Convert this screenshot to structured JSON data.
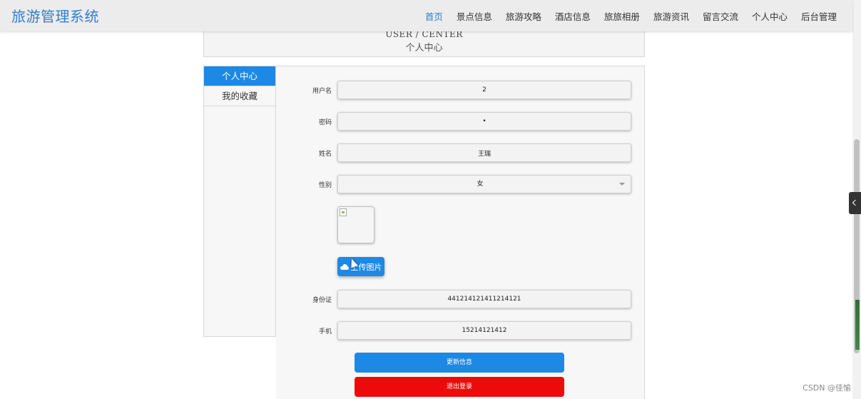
{
  "app": {
    "title": "旅游管理系统"
  },
  "nav": {
    "items": [
      "首页",
      "景点信息",
      "旅游攻略",
      "酒店信息",
      "旅旅相册",
      "旅游资讯",
      "留言交流",
      "个人中心",
      "后台管理"
    ],
    "active_index": 0
  },
  "section_header": {
    "english": "USER / CENTER",
    "chinese": "个人中心"
  },
  "sidebar": {
    "items": [
      "个人中心",
      "我的收藏"
    ],
    "active_index": 0
  },
  "form": {
    "username": {
      "label": "用户名",
      "value": "2"
    },
    "password": {
      "label": "密码",
      "value": "•"
    },
    "name": {
      "label": "姓名",
      "value": "王瑞"
    },
    "gender": {
      "label": "性别",
      "value": "女"
    },
    "upload_label": "上传图片",
    "id_card": {
      "label": "身份证",
      "value": "441214121411214121"
    },
    "phone": {
      "label": "手机",
      "value": "15214121412"
    }
  },
  "buttons": {
    "update": "更新信息",
    "logout": "退出登录"
  },
  "watermark": "CSDN @佳愉",
  "colors": {
    "accent": "#1e88e5",
    "danger": "#ee0a0a",
    "brand": "#2f7fd4"
  }
}
